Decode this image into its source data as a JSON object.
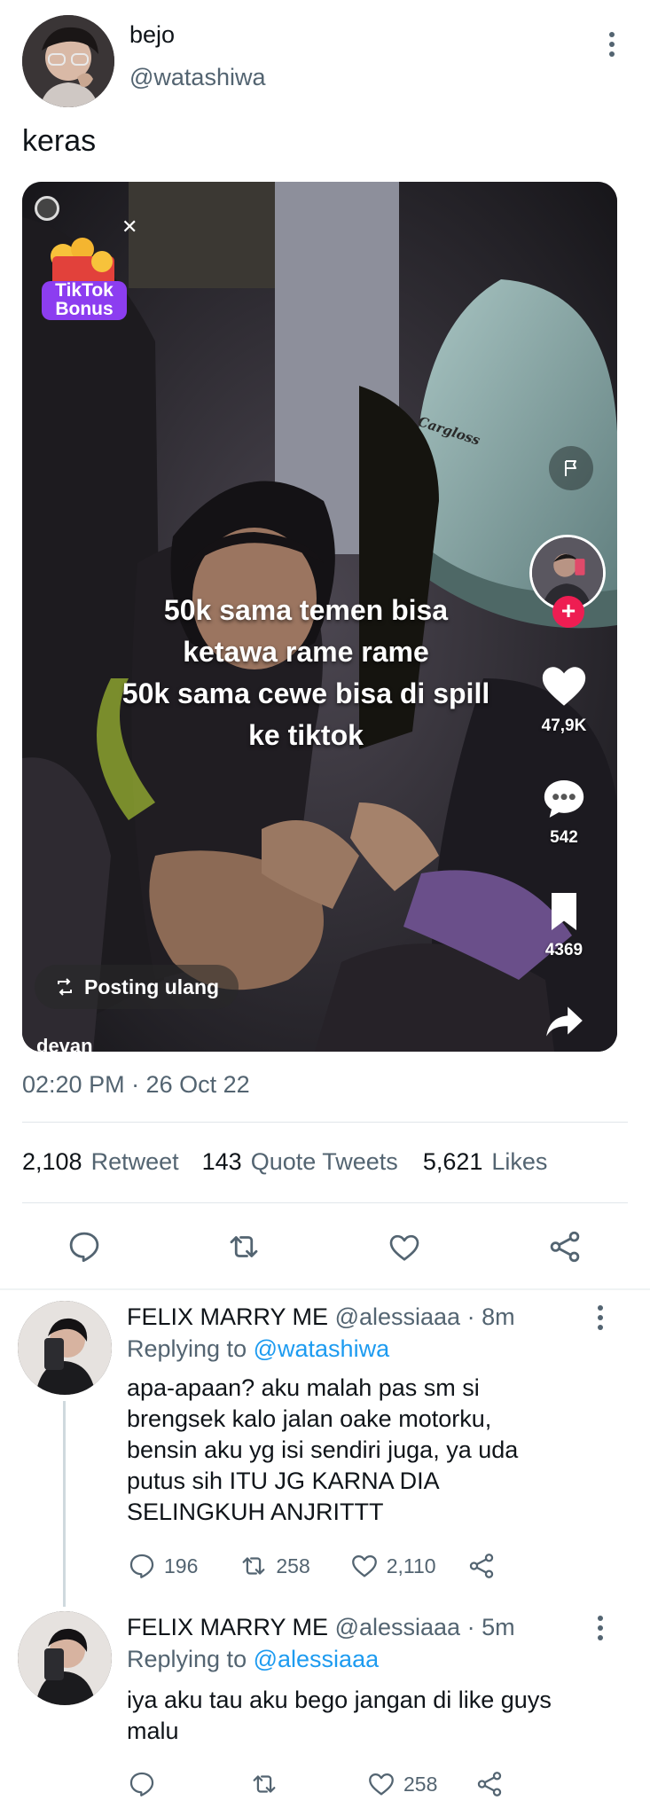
{
  "tweet": {
    "author_name": "bejo",
    "handle": "@watashiwa",
    "text": "keras",
    "timestamp": "02:20 PM · 26 Oct 22",
    "stats": {
      "retweets_count": "2,108",
      "retweets_label": "Retweet",
      "quotes_count": "143",
      "quotes_label": "Quote Tweets",
      "likes_count": "5,621",
      "likes_label": "Likes"
    }
  },
  "media": {
    "bonus_line1": "TikTok",
    "bonus_line2": "Bonus",
    "helmet_text": "Cargloss",
    "caption_lines": [
      "50k sama temen bisa",
      "ketawa rame rame",
      "50k sama cewe bisa di spill",
      "ke tiktok"
    ],
    "likes": "47,9K",
    "comments": "542",
    "bookmarks": "4369",
    "repost_label": "Posting ulang",
    "username_partial": "devan"
  },
  "replies": [
    {
      "name": "FELIX MARRY ME",
      "handle": "@alessiaaa",
      "time": "· 8m",
      "replying_label": "Replying to",
      "replying_handle": "@watashiwa",
      "text_lines": [
        "apa-apaan? aku malah pas sm si",
        "brengsek kalo jalan oake motorku,",
        "bensin aku yg isi sendiri juga, ya uda",
        "putus sih ITU JG KARNA DIA",
        "SELINGKUH ANJRITTT"
      ],
      "replies_count": "196",
      "retweets_count": "258",
      "likes_count": "2,110"
    },
    {
      "name": "FELIX MARRY ME",
      "handle": "@alessiaaa",
      "time": "· 5m",
      "replying_label": "Replying to",
      "replying_handle": "@alessiaaa",
      "text_lines": [
        "iya aku tau aku bego jangan di like guys",
        "malu"
      ],
      "likes_count": "258"
    }
  ],
  "colors": {
    "text": "#0f1419",
    "muted": "#536471",
    "link": "#1d9bf0",
    "divider": "#e1e6ea"
  }
}
